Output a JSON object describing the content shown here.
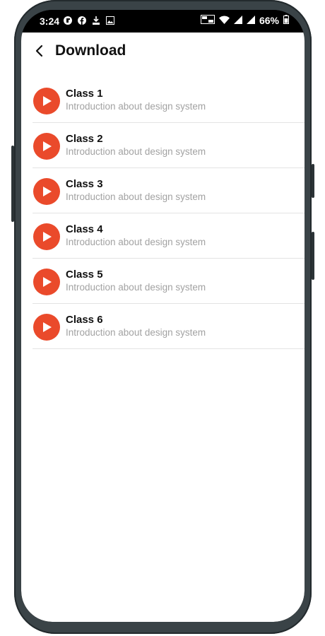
{
  "status_bar": {
    "time": "3:24",
    "battery": "66%",
    "left_icons": [
      "vpn-icon",
      "facebook-icon",
      "download-notification-icon",
      "image-icon"
    ],
    "right_icons": [
      "volte-icon",
      "wifi-icon",
      "signal-icon",
      "signal-icon",
      "battery-icon"
    ]
  },
  "header": {
    "back_icon": "back-arrow-icon",
    "title": "Download"
  },
  "colors": {
    "accent": "#ea4a2b",
    "title_text": "#111111",
    "subtitle_text": "#a2a2a2",
    "divider": "#e3e3e3"
  },
  "classes": [
    {
      "title": "Class 1",
      "subtitle": "Introduction about design system",
      "icon": "play-icon"
    },
    {
      "title": "Class 2",
      "subtitle": "Introduction about design system",
      "icon": "play-icon"
    },
    {
      "title": "Class 3",
      "subtitle": "Introduction about design system",
      "icon": "play-icon"
    },
    {
      "title": "Class 4",
      "subtitle": "Introduction about design system",
      "icon": "play-icon"
    },
    {
      "title": "Class 5",
      "subtitle": "Introduction about design system",
      "icon": "play-icon"
    },
    {
      "title": "Class 6",
      "subtitle": "Introduction about design system",
      "icon": "play-icon"
    }
  ]
}
